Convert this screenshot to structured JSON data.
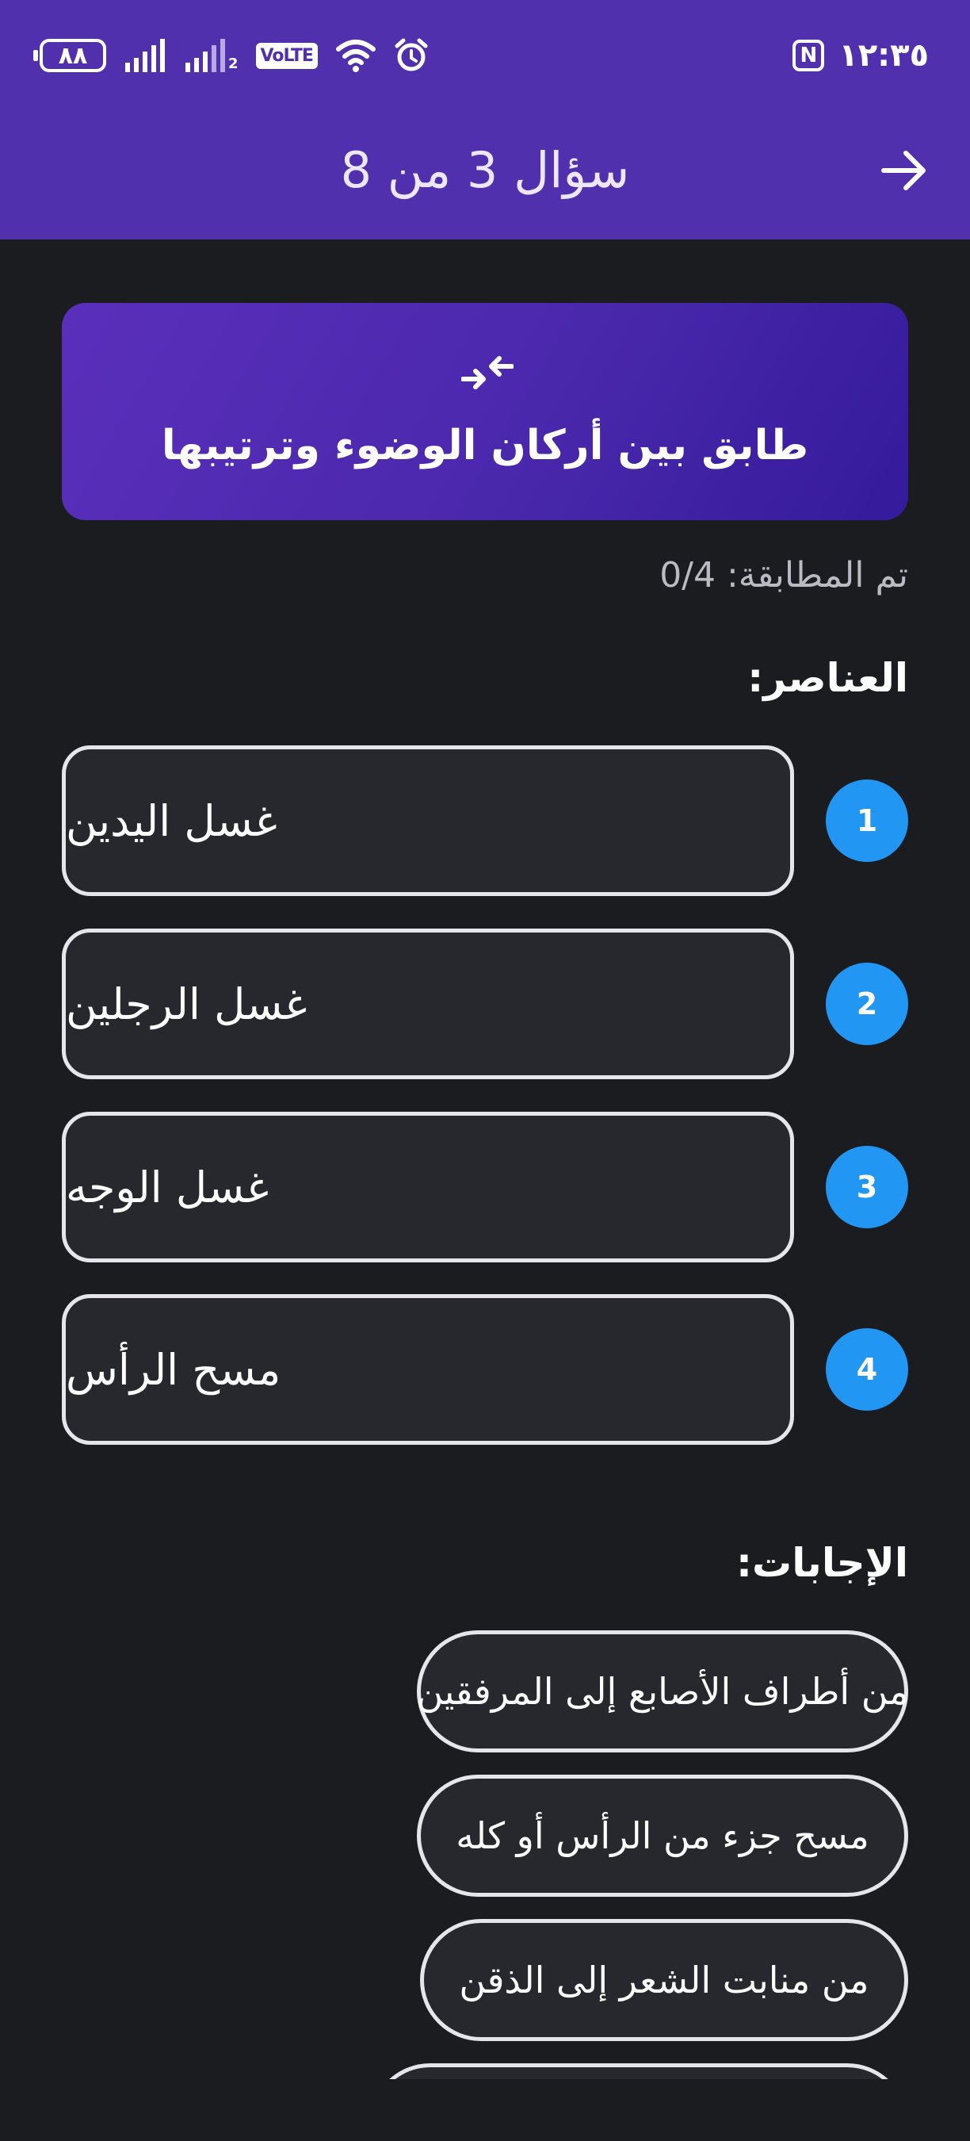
{
  "status_bar": {
    "battery": "٨٨",
    "volte": "VoLTE",
    "sim2": "2",
    "nfc": "N",
    "time": "١٢:٣٥"
  },
  "header": {
    "title": "سؤال 3 من 8"
  },
  "question": {
    "icon": "compress-arrows-icon",
    "text": "طابق بين أركان الوضوء وترتيبها"
  },
  "progress_text": "تم المطابقة: 0/4",
  "items_title": "العناصر:",
  "items": [
    {
      "number": "1",
      "label": "غسل اليدين"
    },
    {
      "number": "2",
      "label": "غسل الرجلين"
    },
    {
      "number": "3",
      "label": "غسل الوجه"
    },
    {
      "number": "4",
      "label": "مسح الرأس"
    }
  ],
  "answers_title": "الإجابات:",
  "answers": [
    {
      "label": "من أطراف الأصابع إلى المرفقين"
    },
    {
      "label": "مسح جزء من الرأس أو كله"
    },
    {
      "label": "من منابت الشعر إلى الذقن"
    },
    {
      "label": ""
    }
  ],
  "colors": {
    "primary": "#5030ad",
    "card_gradient_end": "#341b9b",
    "badge": "#2196f3",
    "background": "#1b1c20",
    "item_fill": "#27282d"
  }
}
